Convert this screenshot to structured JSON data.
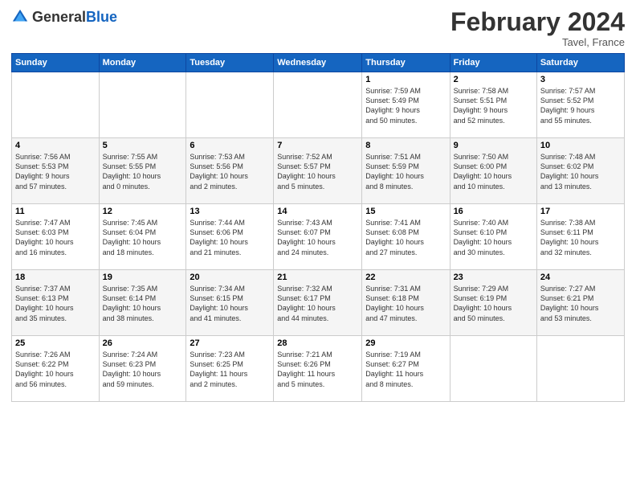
{
  "logo": {
    "text_general": "General",
    "text_blue": "Blue"
  },
  "header": {
    "month_title": "February 2024",
    "location": "Tavel, France"
  },
  "days_of_week": [
    "Sunday",
    "Monday",
    "Tuesday",
    "Wednesday",
    "Thursday",
    "Friday",
    "Saturday"
  ],
  "weeks": [
    [
      {
        "day": "",
        "info": ""
      },
      {
        "day": "",
        "info": ""
      },
      {
        "day": "",
        "info": ""
      },
      {
        "day": "",
        "info": ""
      },
      {
        "day": "1",
        "info": "Sunrise: 7:59 AM\nSunset: 5:49 PM\nDaylight: 9 hours\nand 50 minutes."
      },
      {
        "day": "2",
        "info": "Sunrise: 7:58 AM\nSunset: 5:51 PM\nDaylight: 9 hours\nand 52 minutes."
      },
      {
        "day": "3",
        "info": "Sunrise: 7:57 AM\nSunset: 5:52 PM\nDaylight: 9 hours\nand 55 minutes."
      }
    ],
    [
      {
        "day": "4",
        "info": "Sunrise: 7:56 AM\nSunset: 5:53 PM\nDaylight: 9 hours\nand 57 minutes."
      },
      {
        "day": "5",
        "info": "Sunrise: 7:55 AM\nSunset: 5:55 PM\nDaylight: 10 hours\nand 0 minutes."
      },
      {
        "day": "6",
        "info": "Sunrise: 7:53 AM\nSunset: 5:56 PM\nDaylight: 10 hours\nand 2 minutes."
      },
      {
        "day": "7",
        "info": "Sunrise: 7:52 AM\nSunset: 5:57 PM\nDaylight: 10 hours\nand 5 minutes."
      },
      {
        "day": "8",
        "info": "Sunrise: 7:51 AM\nSunset: 5:59 PM\nDaylight: 10 hours\nand 8 minutes."
      },
      {
        "day": "9",
        "info": "Sunrise: 7:50 AM\nSunset: 6:00 PM\nDaylight: 10 hours\nand 10 minutes."
      },
      {
        "day": "10",
        "info": "Sunrise: 7:48 AM\nSunset: 6:02 PM\nDaylight: 10 hours\nand 13 minutes."
      }
    ],
    [
      {
        "day": "11",
        "info": "Sunrise: 7:47 AM\nSunset: 6:03 PM\nDaylight: 10 hours\nand 16 minutes."
      },
      {
        "day": "12",
        "info": "Sunrise: 7:45 AM\nSunset: 6:04 PM\nDaylight: 10 hours\nand 18 minutes."
      },
      {
        "day": "13",
        "info": "Sunrise: 7:44 AM\nSunset: 6:06 PM\nDaylight: 10 hours\nand 21 minutes."
      },
      {
        "day": "14",
        "info": "Sunrise: 7:43 AM\nSunset: 6:07 PM\nDaylight: 10 hours\nand 24 minutes."
      },
      {
        "day": "15",
        "info": "Sunrise: 7:41 AM\nSunset: 6:08 PM\nDaylight: 10 hours\nand 27 minutes."
      },
      {
        "day": "16",
        "info": "Sunrise: 7:40 AM\nSunset: 6:10 PM\nDaylight: 10 hours\nand 30 minutes."
      },
      {
        "day": "17",
        "info": "Sunrise: 7:38 AM\nSunset: 6:11 PM\nDaylight: 10 hours\nand 32 minutes."
      }
    ],
    [
      {
        "day": "18",
        "info": "Sunrise: 7:37 AM\nSunset: 6:13 PM\nDaylight: 10 hours\nand 35 minutes."
      },
      {
        "day": "19",
        "info": "Sunrise: 7:35 AM\nSunset: 6:14 PM\nDaylight: 10 hours\nand 38 minutes."
      },
      {
        "day": "20",
        "info": "Sunrise: 7:34 AM\nSunset: 6:15 PM\nDaylight: 10 hours\nand 41 minutes."
      },
      {
        "day": "21",
        "info": "Sunrise: 7:32 AM\nSunset: 6:17 PM\nDaylight: 10 hours\nand 44 minutes."
      },
      {
        "day": "22",
        "info": "Sunrise: 7:31 AM\nSunset: 6:18 PM\nDaylight: 10 hours\nand 47 minutes."
      },
      {
        "day": "23",
        "info": "Sunrise: 7:29 AM\nSunset: 6:19 PM\nDaylight: 10 hours\nand 50 minutes."
      },
      {
        "day": "24",
        "info": "Sunrise: 7:27 AM\nSunset: 6:21 PM\nDaylight: 10 hours\nand 53 minutes."
      }
    ],
    [
      {
        "day": "25",
        "info": "Sunrise: 7:26 AM\nSunset: 6:22 PM\nDaylight: 10 hours\nand 56 minutes."
      },
      {
        "day": "26",
        "info": "Sunrise: 7:24 AM\nSunset: 6:23 PM\nDaylight: 10 hours\nand 59 minutes."
      },
      {
        "day": "27",
        "info": "Sunrise: 7:23 AM\nSunset: 6:25 PM\nDaylight: 11 hours\nand 2 minutes."
      },
      {
        "day": "28",
        "info": "Sunrise: 7:21 AM\nSunset: 6:26 PM\nDaylight: 11 hours\nand 5 minutes."
      },
      {
        "day": "29",
        "info": "Sunrise: 7:19 AM\nSunset: 6:27 PM\nDaylight: 11 hours\nand 8 minutes."
      },
      {
        "day": "",
        "info": ""
      },
      {
        "day": "",
        "info": ""
      }
    ]
  ]
}
